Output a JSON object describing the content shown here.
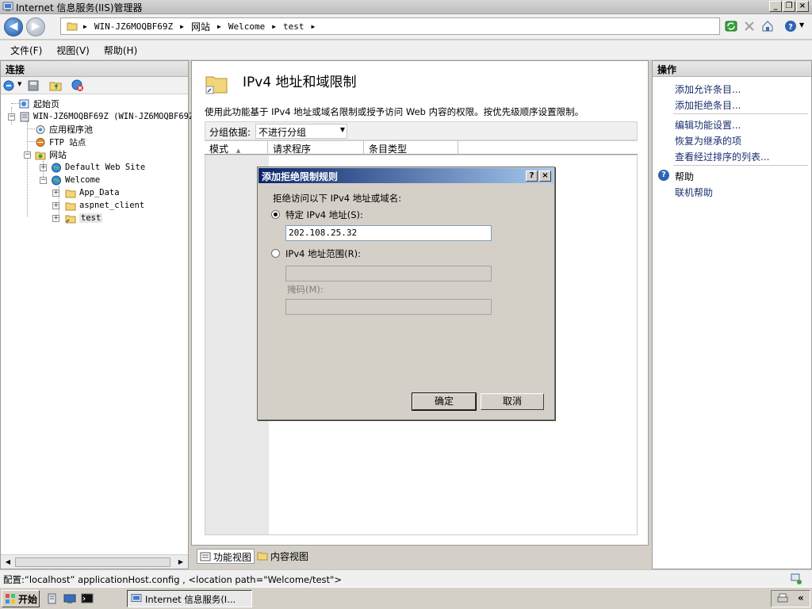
{
  "window": {
    "title": "Internet 信息服务(IIS)管理器",
    "minimize": "_",
    "maximize": "❐",
    "close": "×"
  },
  "address": {
    "crumbs": [
      "WIN-JZ6MOQBF69Z",
      "网站",
      "Welcome",
      "test"
    ]
  },
  "menu": {
    "file": "文件(F)",
    "view": "视图(V)",
    "help": "帮助(H)"
  },
  "connections": {
    "header": "连接",
    "tree": {
      "start_page": "起始页",
      "server": "WIN-JZ6MOQBF69Z (WIN-JZ6MOQBF69Z",
      "app_pools": "应用程序池",
      "ftp_sites": "FTP 站点",
      "sites": "网站",
      "default_site": "Default Web Site",
      "welcome": "Welcome",
      "app_data": "App_Data",
      "aspnet_client": "aspnet_client",
      "test": "test"
    }
  },
  "feature": {
    "title": "IPv4 地址和域限制",
    "description": "使用此功能基于 IPv4 地址或域名限制或授予访问 Web 内容的权限。按优先级顺序设置限制。",
    "groupby_label": "分组依据:",
    "groupby_value": "不进行分组",
    "columns": [
      "模式",
      "请求程序",
      "条目类型"
    ],
    "tab_feature_view": "功能视图",
    "tab_content_view": "内容视图"
  },
  "actions": {
    "header": "操作",
    "items": [
      "添加允许条目...",
      "添加拒绝条目...",
      "编辑功能设置...",
      "恢复为继承的项",
      "查看经过排序的列表..."
    ],
    "help": "帮助",
    "online_help": "联机帮助"
  },
  "dialog": {
    "title": "添加拒绝限制规则",
    "help_btn": "?",
    "close_btn": "×",
    "prompt": "拒绝访问以下 IPv4 地址或域名:",
    "specific_label": "特定 IPv4 地址(S):",
    "specific_value": "202.108.25.32",
    "range_label": "IPv4 地址范围(R):",
    "range_value": "",
    "mask_label": "掩码(M):",
    "mask_value": "",
    "ok": "确定",
    "cancel": "取消"
  },
  "status": {
    "text": "配置:“localhost” applicationHost.config , <location path=\"Welcome/test\">"
  },
  "taskbar": {
    "start": "开始",
    "task": "Internet 信息服务(I..."
  }
}
